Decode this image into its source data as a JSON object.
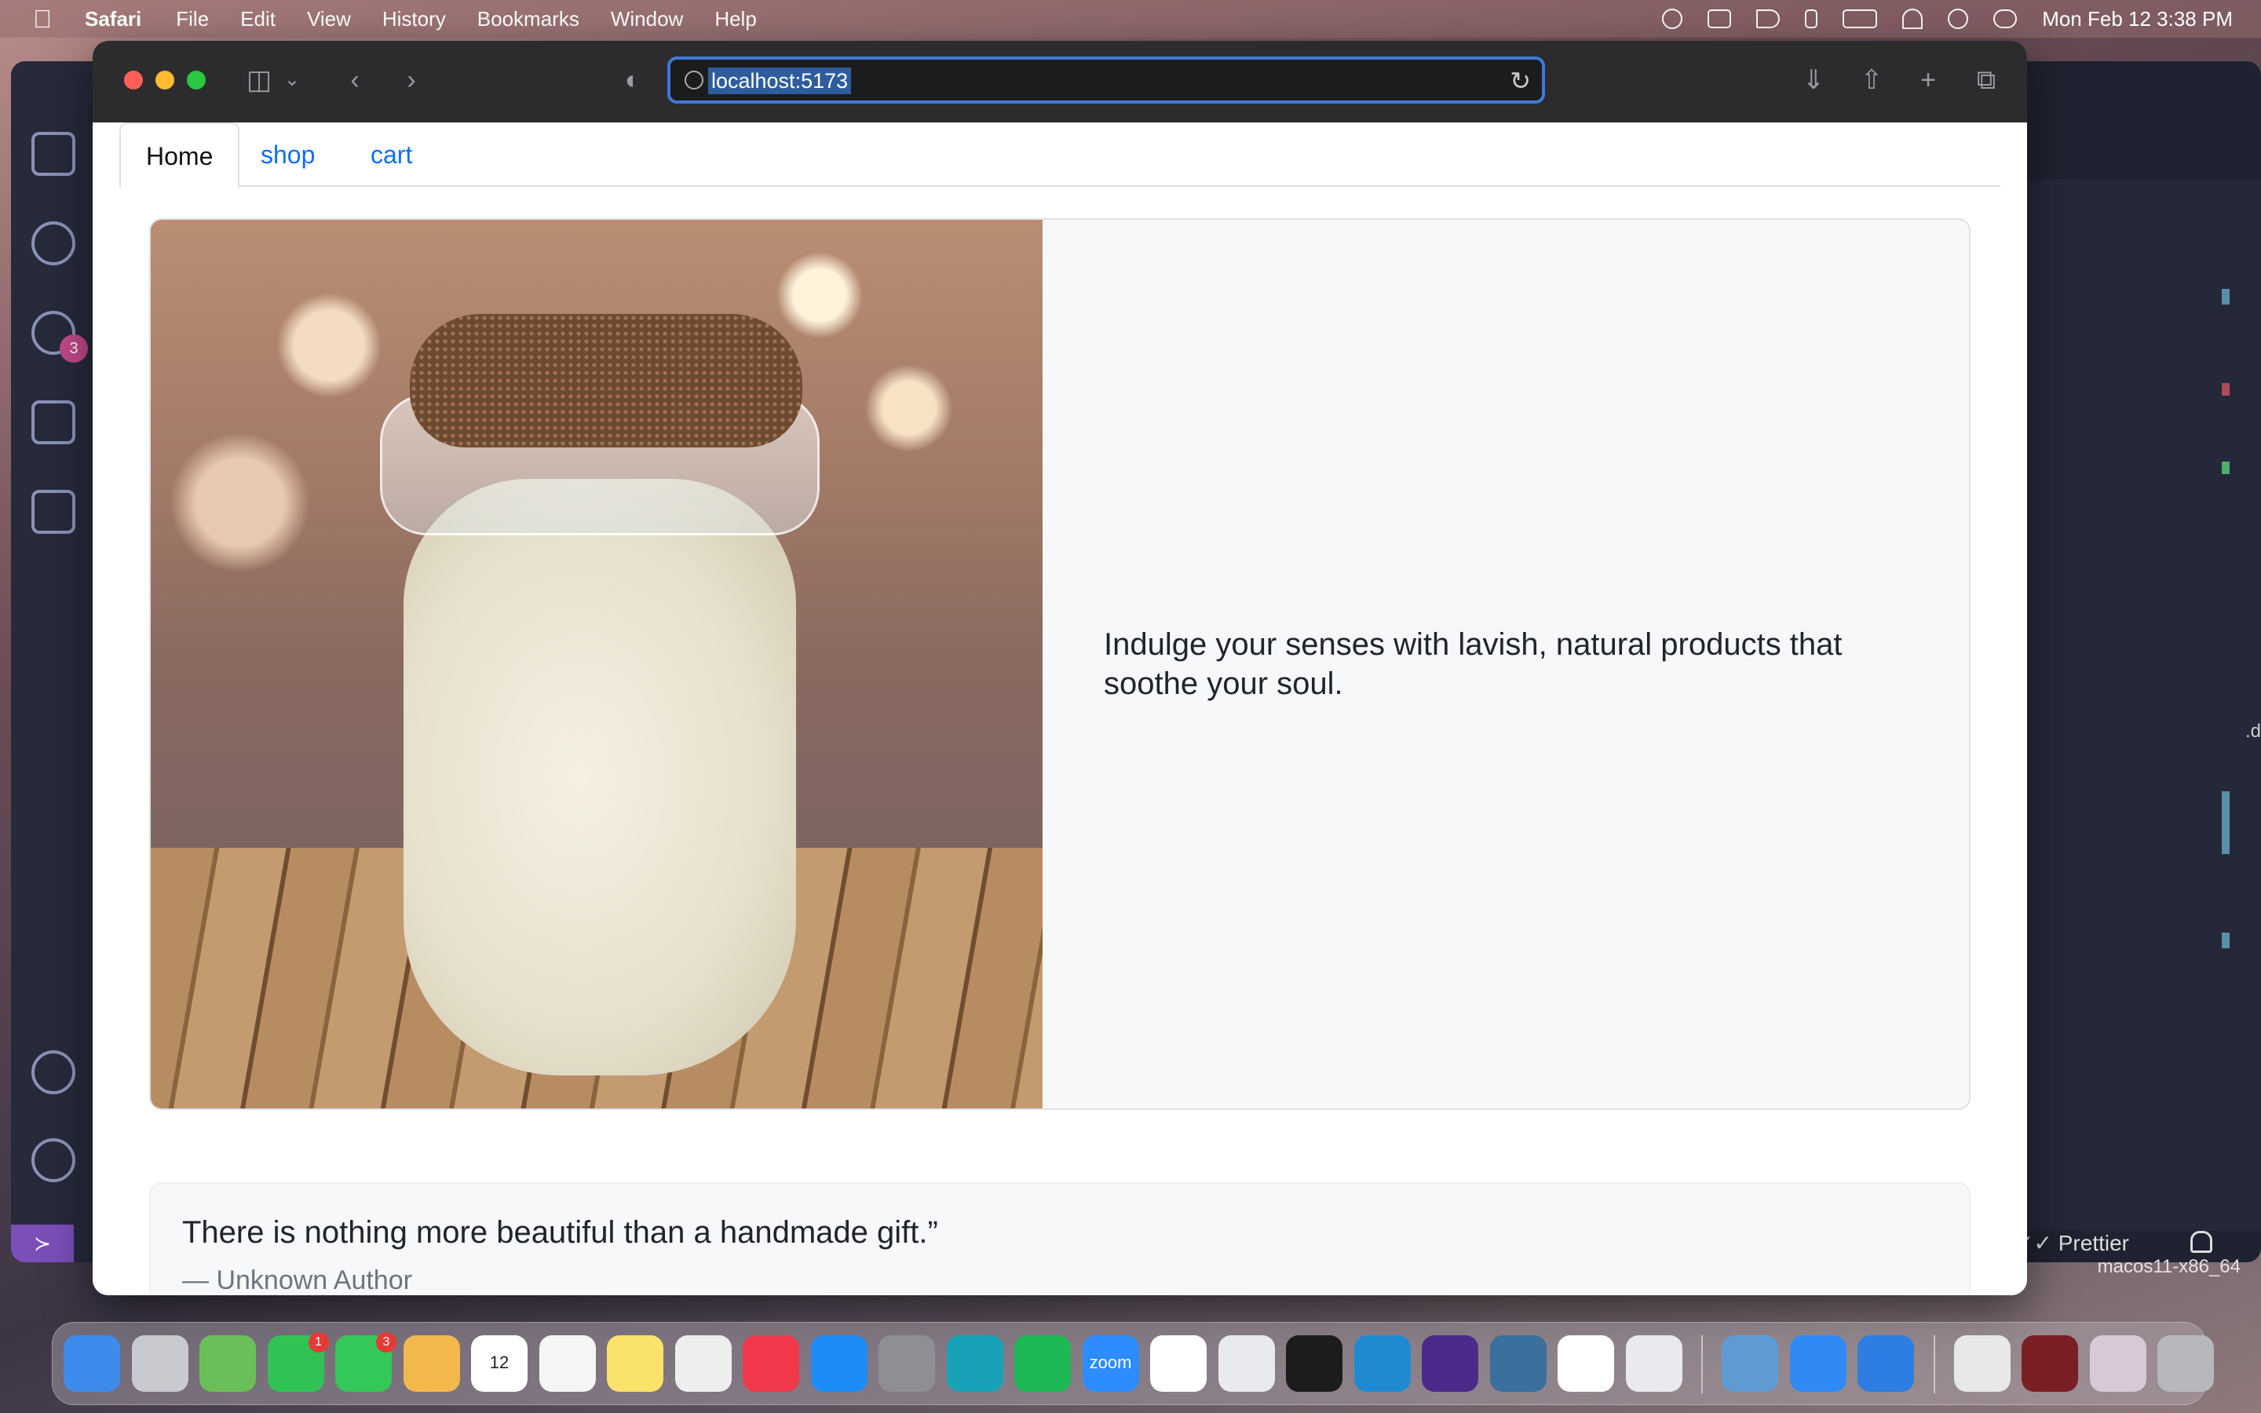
{
  "menubar": {
    "app_name": "Safari",
    "menus": [
      "File",
      "Edit",
      "View",
      "History",
      "Bookmarks",
      "Window",
      "Help"
    ],
    "clock": "Mon Feb 12  3:38 PM"
  },
  "safari": {
    "url": "localhost:5173"
  },
  "page": {
    "tabs": [
      "Home",
      "shop",
      "cart"
    ],
    "active_tab": "Home",
    "hero_text": "Indulge your senses with lavish, natural products that soothe your soul.",
    "quote_text": "There is nothing more beautiful than a handmade gift.”",
    "quote_author": "— Unknown Author"
  },
  "vscode": {
    "source_control_badge": "3",
    "status_prettier": "✓✓ Prettier",
    "host_label": "macos11-x86_64",
    "side_label": ".d"
  },
  "dock": {
    "apps": [
      {
        "name": "finder",
        "color": "#3d8bea"
      },
      {
        "name": "launchpad",
        "color": "#c9c9d0"
      },
      {
        "name": "maps",
        "color": "#6bbf59"
      },
      {
        "name": "facetime",
        "color": "#30c254",
        "badge": "1"
      },
      {
        "name": "messages",
        "color": "#34c759",
        "badge": "3"
      },
      {
        "name": "photos",
        "color": "#f2b84b"
      },
      {
        "name": "calendar",
        "color": "#ffffff",
        "label": "12"
      },
      {
        "name": "reminders",
        "color": "#f5f5f5"
      },
      {
        "name": "notes",
        "color": "#fbe26a"
      },
      {
        "name": "textedit",
        "color": "#eeeeee"
      },
      {
        "name": "news",
        "color": "#f2384b"
      },
      {
        "name": "app-store",
        "color": "#1e8cf6"
      },
      {
        "name": "system-preferences",
        "color": "#8e8e93"
      },
      {
        "name": "kindle",
        "color": "#17a2b8"
      },
      {
        "name": "spotify",
        "color": "#1db954"
      },
      {
        "name": "zoom",
        "color": "#2d8cff",
        "label": "zoom"
      },
      {
        "name": "slack",
        "color": "#ffffff"
      },
      {
        "name": "chrome-dev",
        "color": "#e8eaed"
      },
      {
        "name": "terminal",
        "color": "#1c1c1c"
      },
      {
        "name": "vscode",
        "color": "#1f8ad2"
      },
      {
        "name": "tor",
        "color": "#4b2a8a"
      },
      {
        "name": "mysql-workbench",
        "color": "#3a6f9e"
      },
      {
        "name": "mongodb-compass",
        "color": "#ffffff"
      },
      {
        "name": "chrome",
        "color": "#e8eaed"
      },
      {
        "name": "preview",
        "color": "#5f9bd3"
      },
      {
        "name": "mail",
        "color": "#2f8af5"
      },
      {
        "name": "safari",
        "color": "#2e7de0"
      },
      {
        "name": "document",
        "color": "#e8e8e8"
      },
      {
        "name": "screenshot-stack",
        "color": "#7a1f24"
      },
      {
        "name": "browser-stack",
        "color": "#d8c8d8"
      },
      {
        "name": "trash",
        "color": "#b8b8bc"
      }
    ]
  }
}
